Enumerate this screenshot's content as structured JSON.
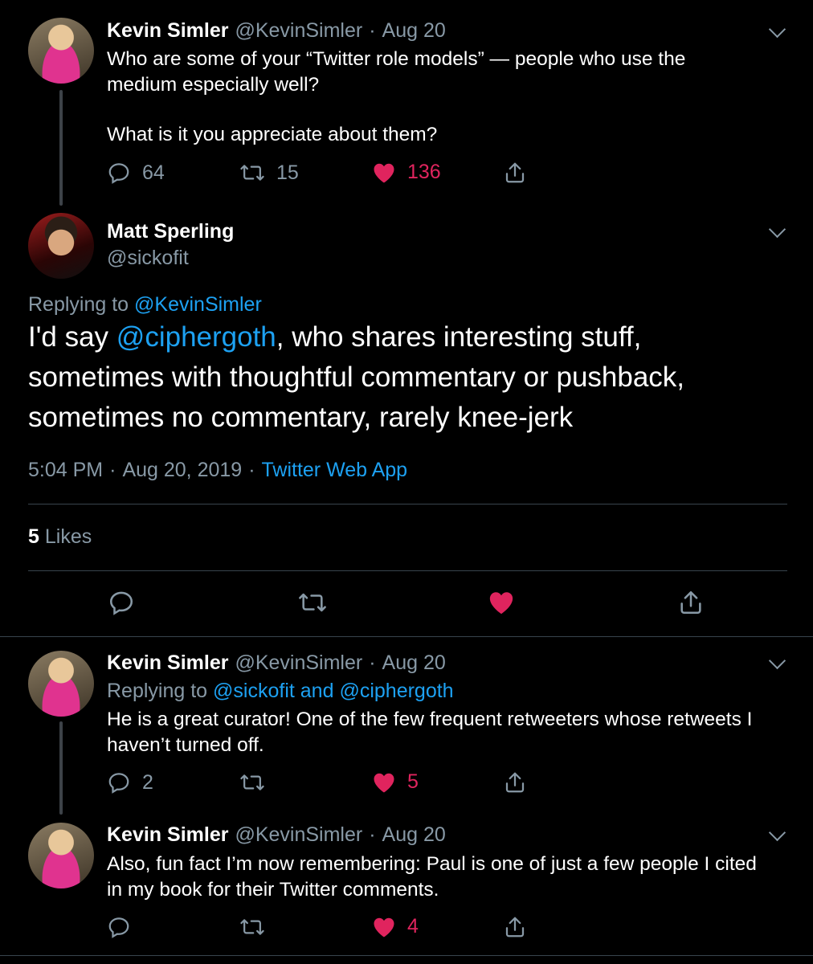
{
  "tweet1": {
    "name": "Kevin Simler",
    "handle": "@KevinSimler",
    "dot": "·",
    "date": "Aug 20",
    "line1": "Who are some of your “Twitter role models” — people who use the",
    "line2": "medium especially well?",
    "line3": "What is it you appreciate about them?",
    "replies": "64",
    "retweets": "15",
    "likes": "136"
  },
  "main": {
    "name": "Matt Sperling",
    "handle": "@sickofit",
    "replying_prefix": "Replying to",
    "replying_to": "@KevinSimler",
    "line1_pre": "I'd say",
    "line1_mention": "@ciphergoth",
    "line1_post": ", who shares interesting stuff,",
    "line2": "sometimes with thoughtful commentary or pushback,",
    "line3": "sometimes no commentary, rarely knee-jerk",
    "time": "5:04 PM",
    "sep": "·",
    "full_date": "Aug 20, 2019",
    "source": "Twitter Web App",
    "likes_count": "5",
    "likes_label": "Likes"
  },
  "reply1": {
    "name": "Kevin Simler",
    "handle": "@KevinSimler",
    "dot": "·",
    "date": "Aug 20",
    "replying_prefix": "Replying to",
    "mention1": "@sickofit",
    "and": "and",
    "mention2": "@ciphergoth",
    "line1": "He is a great curator! One of the few frequent retweeters whose retweets I",
    "line2": "haven’t turned off.",
    "replies": "2",
    "likes": "5"
  },
  "reply2": {
    "name": "Kevin Simler",
    "handle": "@KevinSimler",
    "dot": "·",
    "date": "Aug 20",
    "line1": "Also, fun fact I’m now remembering: Paul is one of just a few people I cited",
    "line2": "in my book for their Twitter comments.",
    "likes": "4"
  },
  "colors": {
    "accent": "#1da1f2",
    "like": "#e0245e",
    "muted": "#8899a6",
    "bg": "#000000"
  },
  "icons": [
    "reply-icon",
    "retweet-icon",
    "heart-icon",
    "share-icon",
    "chevron-down-icon"
  ]
}
